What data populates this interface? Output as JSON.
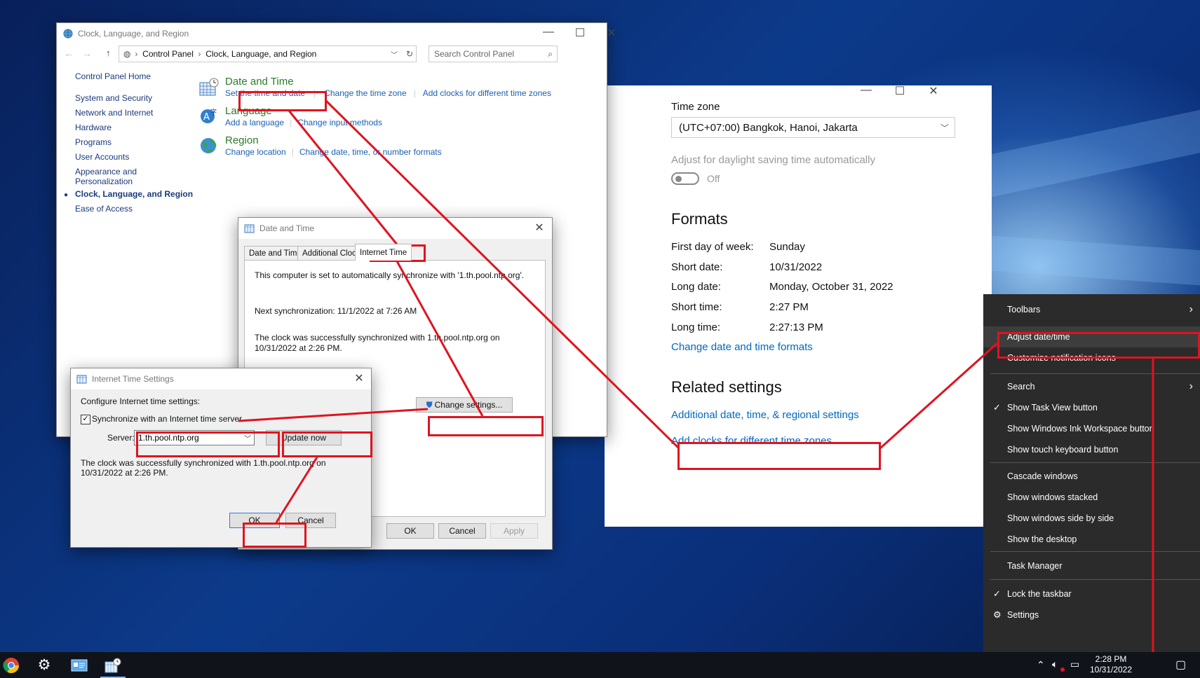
{
  "control_panel": {
    "title": "Clock, Language, and Region",
    "breadcrumb": [
      "Control Panel",
      "Clock, Language, and Region"
    ],
    "search_placeholder": "Search Control Panel",
    "nav": {
      "home": "Control Panel Home",
      "items": [
        "System and Security",
        "Network and Internet",
        "Hardware",
        "Programs",
        "User Accounts",
        "Appearance and",
        "Personalization",
        "Clock, Language, and Region",
        "Ease of Access"
      ]
    },
    "categories": {
      "datetime": {
        "title": "Date and Time",
        "links": [
          "Set the time and date",
          "Change the time zone",
          "Add clocks for different time zones"
        ]
      },
      "language": {
        "title": "Language",
        "links": [
          "Add a language",
          "Change input methods"
        ]
      },
      "region": {
        "title": "Region",
        "links": [
          "Change location",
          "Change date, time, or number formats"
        ]
      }
    }
  },
  "date_time_dialog": {
    "title": "Date and Time",
    "tabs": [
      "Date and Time",
      "Additional Clocks",
      "Internet Time"
    ],
    "sync_text": "This computer is set to automatically synchronize with '1.th.pool.ntp.org'.",
    "next_sync": "Next synchronization: 11/1/2022 at 7:26 AM",
    "success_line1": "The clock was successfully synchronized with 1.th.pool.ntp.org on",
    "success_line2": "10/31/2022 at 2:26 PM.",
    "change_settings": "Change settings...",
    "ok": "OK",
    "cancel": "Cancel",
    "apply": "Apply"
  },
  "internet_time_settings": {
    "title": "Internet Time Settings",
    "configure": "Configure Internet time settings:",
    "sync_checkbox": "Synchronize with an Internet time server",
    "server_label": "Server:",
    "server_value": "1.th.pool.ntp.org",
    "update_now": "Update now",
    "success_line1": "The clock was successfully synchronized with 1.th.pool.ntp.org on",
    "success_line2": "10/31/2022 at 2:26 PM.",
    "ok": "OK",
    "cancel": "Cancel"
  },
  "settings": {
    "time_zone_label": "Time zone",
    "time_zone_value": "(UTC+07:00) Bangkok, Hanoi, Jakarta",
    "dst_label": "Adjust for daylight saving time automatically",
    "dst_state": "Off",
    "formats_header": "Formats",
    "formats": [
      {
        "label": "First day of week:",
        "value": "Sunday"
      },
      {
        "label": "Short date:",
        "value": "10/31/2022"
      },
      {
        "label": "Long date:",
        "value": "Monday, October 31, 2022"
      },
      {
        "label": "Short time:",
        "value": "2:27 PM"
      },
      {
        "label": "Long time:",
        "value": "2:27:13 PM"
      }
    ],
    "change_formats": "Change date and time formats",
    "related_header": "Related settings",
    "additional_settings": "Additional date, time, & regional settings",
    "add_clocks": "Add clocks for different time zones"
  },
  "context_menu": {
    "toolbars": "Toolbars",
    "adjust": "Adjust date/time",
    "customize": "Customize notification icons",
    "search": "Search",
    "task_view": "Show Task View button",
    "ink": "Show Windows Ink Workspace button",
    "touch_kb": "Show touch keyboard button",
    "cascade": "Cascade windows",
    "stacked": "Show windows stacked",
    "side_by_side": "Show windows side by side",
    "desktop": "Show the desktop",
    "task_manager": "Task Manager",
    "lock": "Lock the taskbar",
    "settings": "Settings"
  },
  "taskbar": {
    "time": "2:28 PM",
    "date": "10/31/2022"
  },
  "colors": {
    "annotation": "#e0131f",
    "link": "#1a5fb4",
    "settings_link": "#0067c0",
    "menu_bg": "#2b2b2b"
  }
}
